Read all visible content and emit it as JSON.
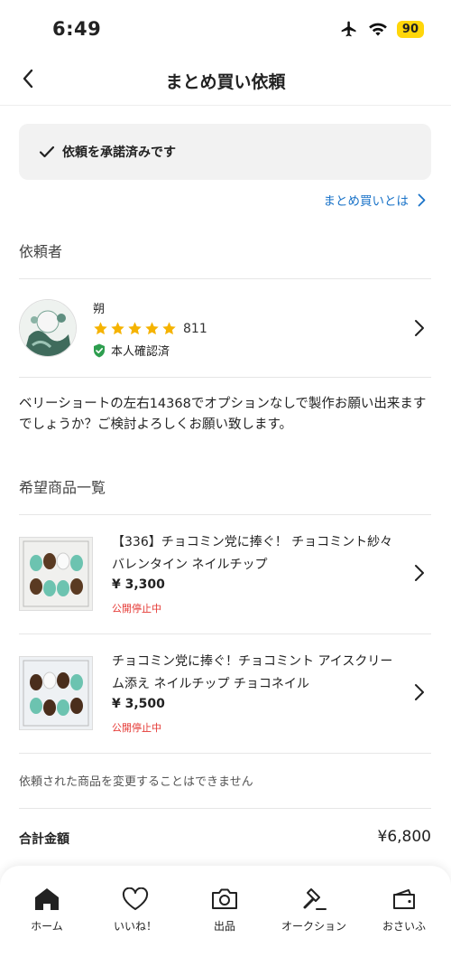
{
  "status_bar": {
    "time": "6:49",
    "battery": "90"
  },
  "header": {
    "title": "まとめ買い依頼"
  },
  "banner": {
    "text": "依頼を承諾済みです"
  },
  "link": {
    "label": "まとめ買いとは"
  },
  "requester_section": {
    "title": "依頼者"
  },
  "requester": {
    "name": "朔",
    "rating_stars": 5,
    "rating_count": "811",
    "verified_label": "本人確認済"
  },
  "message": "ベリーショートの左右14368でオプションなしで製作お願い出来ますでしょうか？ご検討よろしくお願い致します。",
  "products_section": {
    "title": "希望商品一覧"
  },
  "products": [
    {
      "title": "【336】チョコミン党に捧ぐ！ チョコミント紗々 バレンタイン ネイルチップ",
      "price": "¥ 3,300",
      "status": "公開停止中"
    },
    {
      "title": "チョコミン党に捧ぐ！チョコミント アイスクリーム添え ネイルチップ チョコネイル",
      "price": "¥ 3,500",
      "status": "公開停止中"
    }
  ],
  "notice": "依頼された商品を変更することはできません",
  "total": {
    "label": "合計金額",
    "value": "¥6,800"
  },
  "tabs": [
    {
      "label": "ホーム",
      "icon": "home-icon"
    },
    {
      "label": "いいね！",
      "icon": "heart-icon"
    },
    {
      "label": "出品",
      "icon": "camera-icon"
    },
    {
      "label": "オークション",
      "icon": "gavel-icon"
    },
    {
      "label": "おさいふ",
      "icon": "wallet-icon"
    }
  ],
  "colors": {
    "link": "#1a73c8",
    "star": "#f5b301",
    "status_red": "#e53935",
    "verified_green": "#2e9e4f",
    "battery": "#ffd60a"
  }
}
